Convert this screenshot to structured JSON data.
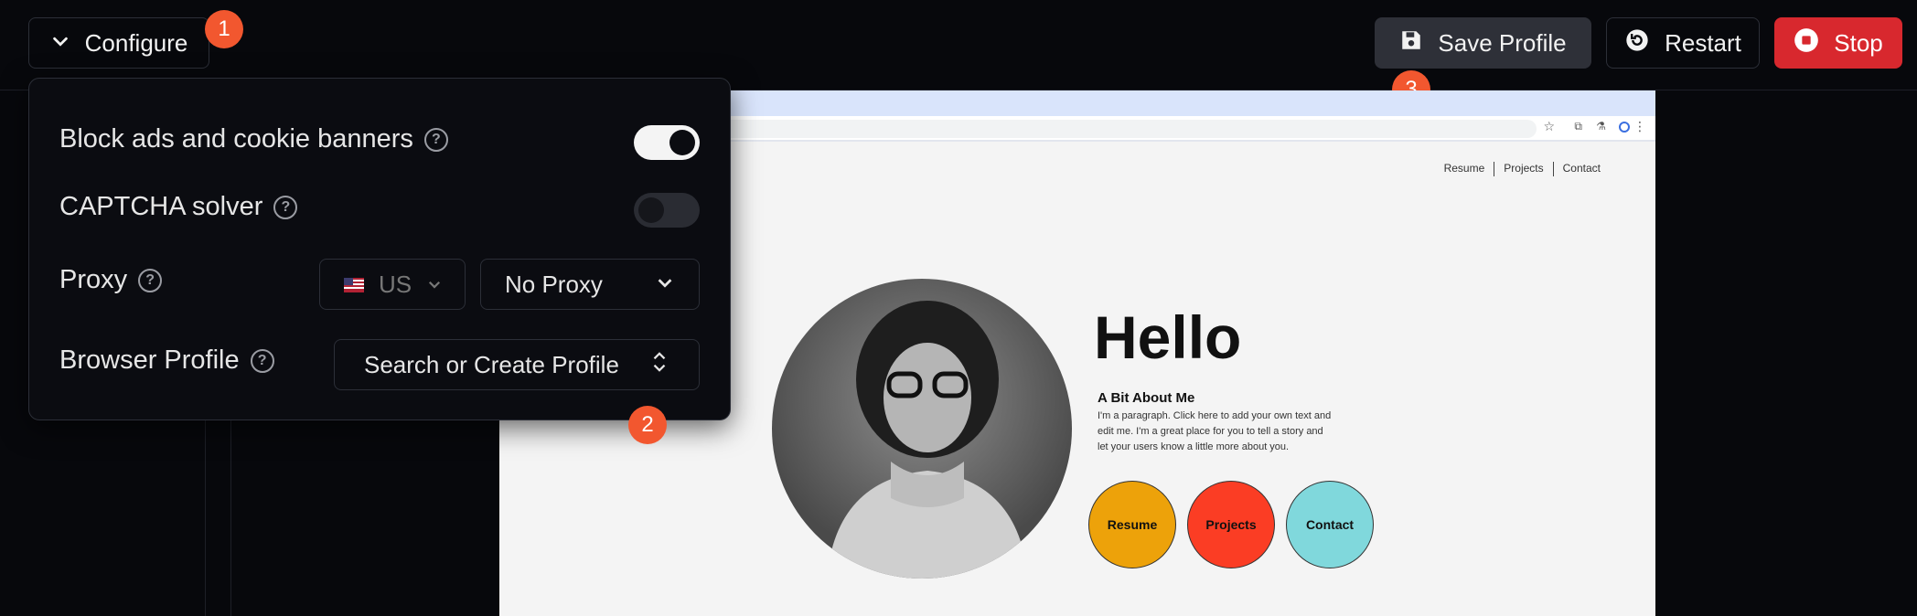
{
  "toolbar": {
    "configure_label": "Configure",
    "save_label": "Save Profile",
    "restart_label": "Restart",
    "stop_label": "Stop"
  },
  "badges": [
    "1",
    "2",
    "3"
  ],
  "config": {
    "block_ads_label": "Block ads and cookie banners",
    "block_ads_enabled": true,
    "captcha_label": "CAPTCHA solver",
    "captcha_enabled": false,
    "proxy_label": "Proxy",
    "proxy_country": "US",
    "proxy_value": "No Proxy",
    "profile_label": "Browser Profile",
    "profile_placeholder": "Search or Create Profile"
  },
  "site": {
    "nav": [
      "Resume",
      "Projects",
      "Contact"
    ],
    "hello": "Hello",
    "about_title": "A Bit About Me",
    "about_text": "I'm a paragraph. Click here to add your own text and edit me. I'm a great place for you to tell a story and let your users know a little more about you.",
    "buttons": [
      {
        "label": "Resume",
        "color": "#eda20a"
      },
      {
        "label": "Projects",
        "color": "#fb3d24"
      },
      {
        "label": "Contact",
        "color": "#80d8dc"
      }
    ]
  },
  "colors": {
    "badge": "#f2572f",
    "stop": "#d8282e",
    "save_bg": "#2e3038"
  }
}
